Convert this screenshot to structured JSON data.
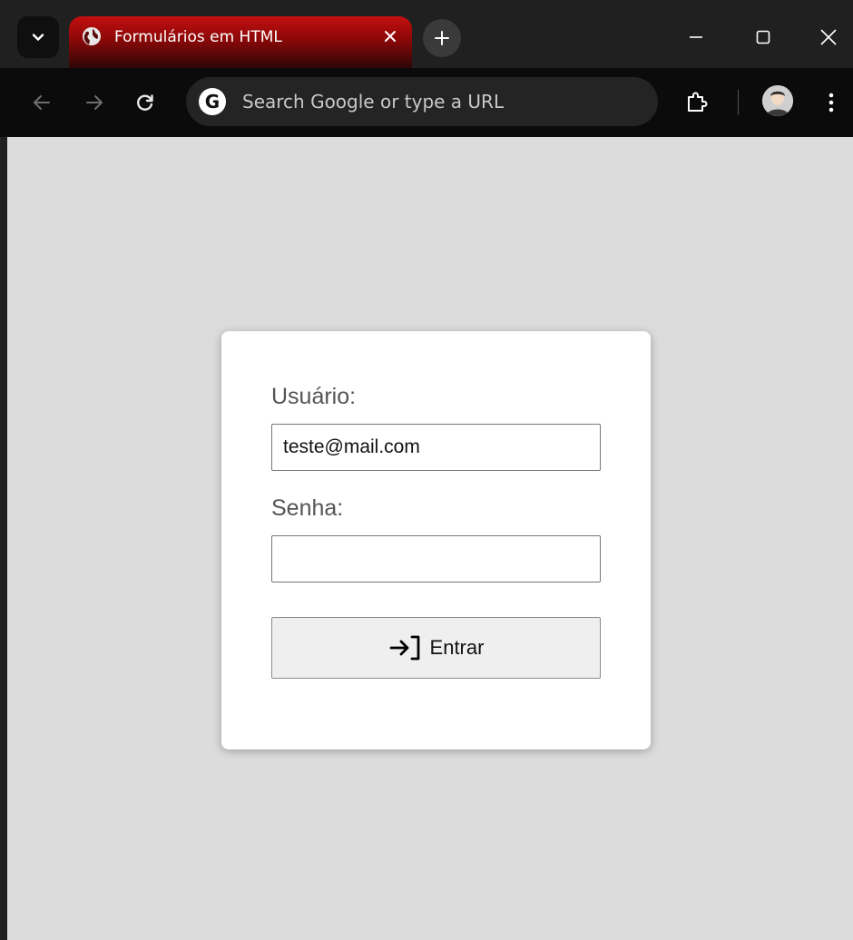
{
  "browser": {
    "tab": {
      "title": "Formulários em HTML"
    },
    "omnibox": {
      "placeholder": "Search Google or type a URL",
      "search_engine_glyph": "G"
    }
  },
  "icons": {
    "tab_search": "chevron-down-icon",
    "favicon": "globe-icon",
    "tab_close": "close-icon",
    "new_tab": "plus-icon",
    "minimize": "minimize-icon",
    "maximize": "maximize-icon",
    "close_window": "close-icon",
    "back": "arrow-left-icon",
    "forward": "arrow-right-icon",
    "reload": "reload-icon",
    "extensions": "puzzle-icon",
    "profile": "avatar",
    "menu": "more-vert-icon",
    "submit": "login-icon"
  },
  "login_form": {
    "user_label": "Usuário:",
    "user_value": "teste@mail.com",
    "password_label": "Senha:",
    "password_value": "",
    "submit_label": "Entrar"
  },
  "colors": {
    "tab_accent": "#c40f0f",
    "page_background": "#dcdcdc",
    "card_background": "#ffffff",
    "label_text": "#555555"
  }
}
